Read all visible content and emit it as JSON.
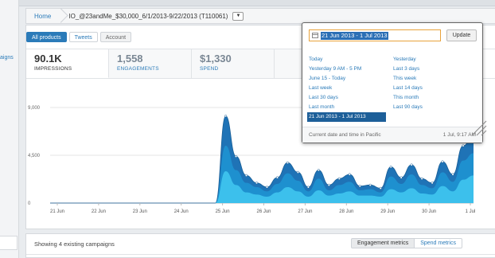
{
  "sidebar": {
    "fragment": "aigns"
  },
  "breadcrumb": {
    "home": "Home",
    "campaign": "IO_@23andMe_$30,000_6/1/2013-9/22/2013 (T110061)",
    "dropdown_icon": "chevron-down-icon"
  },
  "tabs": [
    {
      "label": "All products",
      "active": true
    },
    {
      "label": "Tweets",
      "active": false
    },
    {
      "label": "Account",
      "active": false
    }
  ],
  "metrics": [
    {
      "value": "90.1K",
      "label": "IMPRESSIONS",
      "selected": true
    },
    {
      "value": "1,558",
      "label": "ENGAGEMENTS",
      "selected": false
    },
    {
      "value": "$1,330",
      "label": "SPEND",
      "selected": false
    }
  ],
  "chart_data": {
    "type": "area",
    "title": "",
    "xlabel": "",
    "ylabel": "",
    "ylim": [
      0,
      9000
    ],
    "yticks": [
      "0",
      "4,500",
      "9,000"
    ],
    "x_labels": [
      "21 Jun",
      "22 Jun",
      "23 Jun",
      "24 Jun",
      "25 Jun",
      "26 Jun",
      "27 Jun",
      "28 Jun",
      "29 Jun",
      "30 Jun",
      "1 Jul"
    ],
    "series": [
      {
        "values": [
          0,
          0,
          0,
          0,
          0,
          0,
          0,
          0,
          0,
          0,
          0,
          0,
          0,
          0,
          0,
          0,
          0,
          8200,
          4400,
          2600,
          1900,
          1500,
          2400,
          3800,
          2900,
          1500,
          3100,
          1700,
          2300,
          2700,
          1600,
          1700,
          1400,
          3400,
          2400,
          3600,
          2300,
          1900,
          3900,
          2700,
          5400,
          6400
        ]
      },
      {
        "values": [
          0,
          0,
          0,
          0,
          0,
          0,
          0,
          0,
          0,
          0,
          0,
          0,
          0,
          0,
          0,
          0,
          0,
          5400,
          3100,
          1900,
          1500,
          1100,
          1800,
          2800,
          2100,
          1100,
          2300,
          1200,
          1700,
          2000,
          1200,
          1300,
          1000,
          2500,
          1800,
          2700,
          1700,
          1400,
          2900,
          2000,
          4000,
          4700
        ]
      },
      {
        "values": [
          0,
          0,
          0,
          0,
          0,
          0,
          0,
          0,
          0,
          0,
          0,
          0,
          0,
          0,
          0,
          0,
          0,
          3000,
          1700,
          1000,
          800,
          600,
          1000,
          1500,
          1100,
          600,
          1200,
          700,
          900,
          1100,
          700,
          700,
          600,
          1300,
          1000,
          1400,
          900,
          800,
          1600,
          1100,
          2200,
          2600
        ]
      }
    ]
  },
  "colors": {
    "accent": "#2b7bb9",
    "area_dark": "#1f73b6",
    "area_mid": "#1e90cf",
    "area_light": "#3cc0ec"
  },
  "datepicker": {
    "value": "21 Jun 2013 - 1 Jul 2013",
    "update_label": "Update",
    "col1": [
      "Today",
      "Yesterday 9 AM - 5 PM",
      "June 15 - Today",
      "Last week",
      "Last 30 days",
      "Last month",
      "21 Jun 2013 - 1 Jul 2013"
    ],
    "col2": [
      "Yesterday",
      "Last 3 days",
      "This week",
      "Last 14 days",
      "This month",
      "Last 90 days"
    ],
    "footer_left": "Current date and time in Pacific",
    "footer_right": "1 Jul, 9:17 AM"
  },
  "bottom": {
    "count": "Showing 4 existing campaigns",
    "engagement_btn": "Engagement metrics",
    "spend_btn": "Spend metrics"
  }
}
